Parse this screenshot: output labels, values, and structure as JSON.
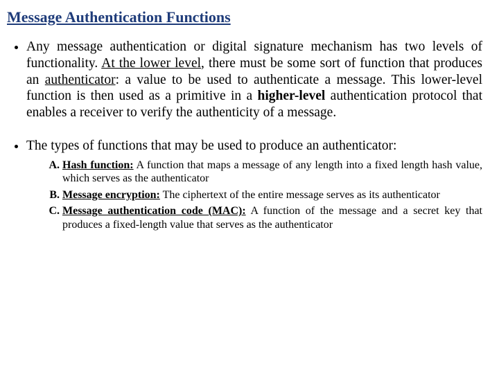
{
  "title": "Message Authentication Functions",
  "p1": {
    "a": "Any message authentication or digital signature mechanism has two levels of functionality. ",
    "lower_u": "At the lower level",
    "b": ", there must be some sort of function that produces an ",
    "auth_u": "authenticator",
    "c": ": a value to be used to authenticate a message. This lower-level function is then used as a primitive in a ",
    "higher_b": "higher-level",
    "d": " authentication protocol that enables a receiver to verify the authenticity of a message."
  },
  "p2": "The types of functions that may be used to produce an authenticator:",
  "items": {
    "a_head": "Hash function:",
    "a_body": " A function that maps a message of any length into a fixed length hash value, which serves as the authenticator",
    "b_head": "Message encryption:",
    "b_body": " The ciphertext of the entire message serves as its authenticator",
    "c_head": "Message authentication code (MAC):",
    "c_body": " A function of the message and a secret key that produces a fixed-length value that serves as the authenticator"
  }
}
